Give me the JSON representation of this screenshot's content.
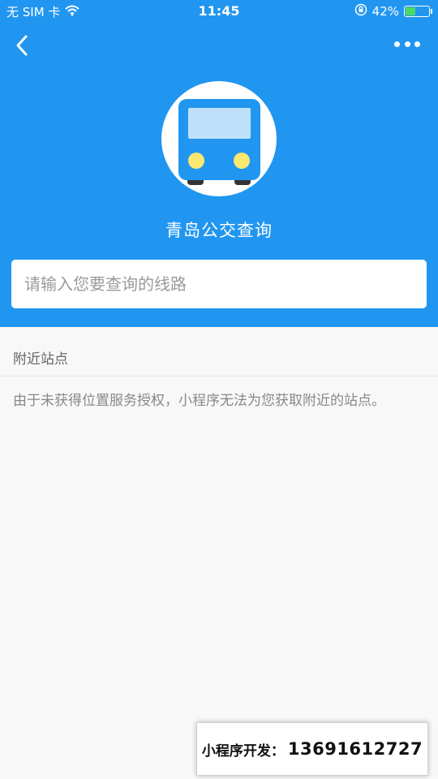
{
  "status_bar": {
    "carrier": "无 SIM 卡",
    "time": "11:45",
    "battery_percent": "42%",
    "battery_level": 0.42,
    "icons": [
      "wifi-icon",
      "orientation-lock-icon",
      "battery-icon"
    ]
  },
  "nav": {
    "back_icon": "chevron-left-icon",
    "more_icon": "more-dots-icon"
  },
  "app": {
    "logo_icon": "bus-icon",
    "title": "青岛公交查询"
  },
  "search": {
    "placeholder": "请输入您要查询的线路",
    "value": ""
  },
  "nearby": {
    "title": "附近站点",
    "notice": "由于未获得位置服务授权，小程序无法为您获取附近的站点。"
  },
  "promo": {
    "label": "小程序开发：",
    "phone": "13691612727"
  },
  "colors": {
    "primary": "#2196f0",
    "bus_body": "#2196f0",
    "bus_window": "#bfe0fb",
    "bus_headlight": "#fbe870",
    "battery_fill": "#4cd964"
  }
}
